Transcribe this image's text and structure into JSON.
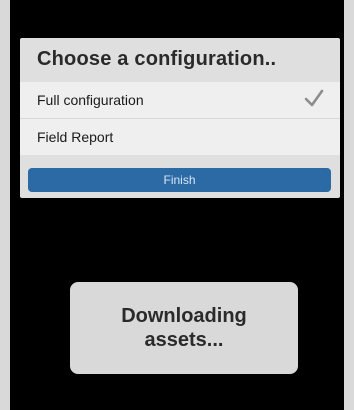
{
  "dialog": {
    "title": "Choose a configuration..",
    "options": [
      {
        "label": "Full configuration",
        "selected": true,
        "icon": "checkmark-icon"
      },
      {
        "label": "Field Report",
        "selected": false
      }
    ],
    "finish_label": "Finish"
  },
  "toast": {
    "message": "Downloading assets..."
  },
  "colors": {
    "accent": "#2c6aa6",
    "screen_background": "#000000",
    "dialog_background": "#dfdfdf"
  }
}
